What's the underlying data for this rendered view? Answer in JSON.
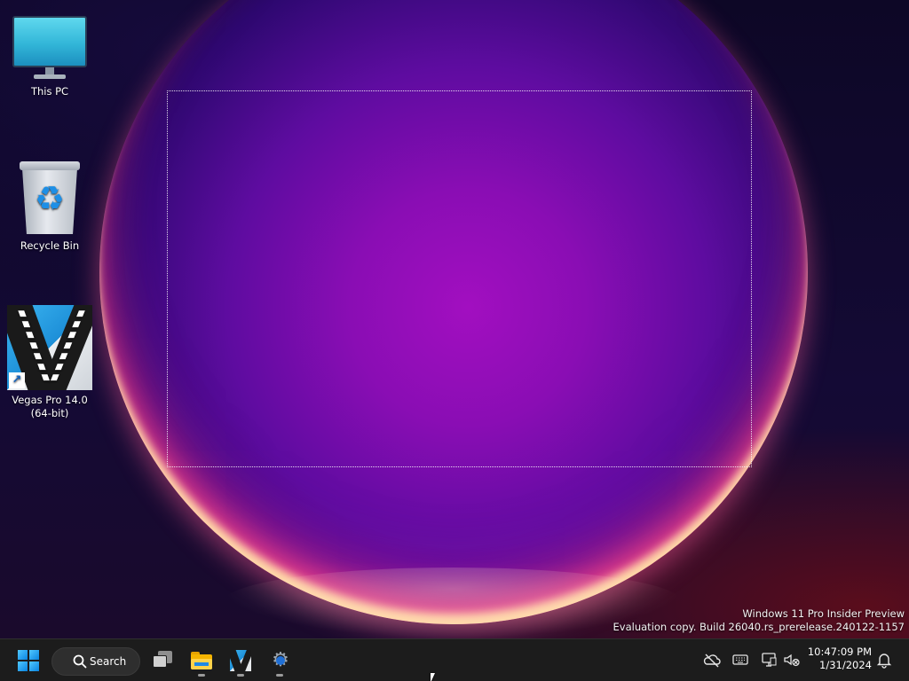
{
  "desktop": {
    "icons": [
      {
        "label": "This PC",
        "icon": "monitor-icon"
      },
      {
        "label": "Recycle Bin",
        "icon": "recycle-bin-icon"
      },
      {
        "label_line1": "Vegas Pro 14.0",
        "label_line2": "(64-bit)",
        "icon": "vegas-pro-icon",
        "shortcut": true
      }
    ],
    "watermark": {
      "line1": "Windows 11 Pro Insider Preview",
      "line2": "Evaluation copy. Build 26040.rs_prerelease.240122-1157"
    }
  },
  "taskbar": {
    "search_label": "Search",
    "pinned": [
      "start-icon",
      "search-icon",
      "task-view-icon",
      "file-explorer-icon",
      "vegas-pro-icon",
      "settings-icon"
    ],
    "tray": {
      "icons": [
        "onedrive-offline-icon",
        "keyboard-icon",
        "network-icon",
        "volume-muted-icon",
        "notification-bell-icon"
      ],
      "time": "10:47:09 PM",
      "date": "1/31/2024"
    }
  },
  "colors": {
    "taskbar_bg": "#1c1c1c",
    "accent": "#0a84e0"
  }
}
